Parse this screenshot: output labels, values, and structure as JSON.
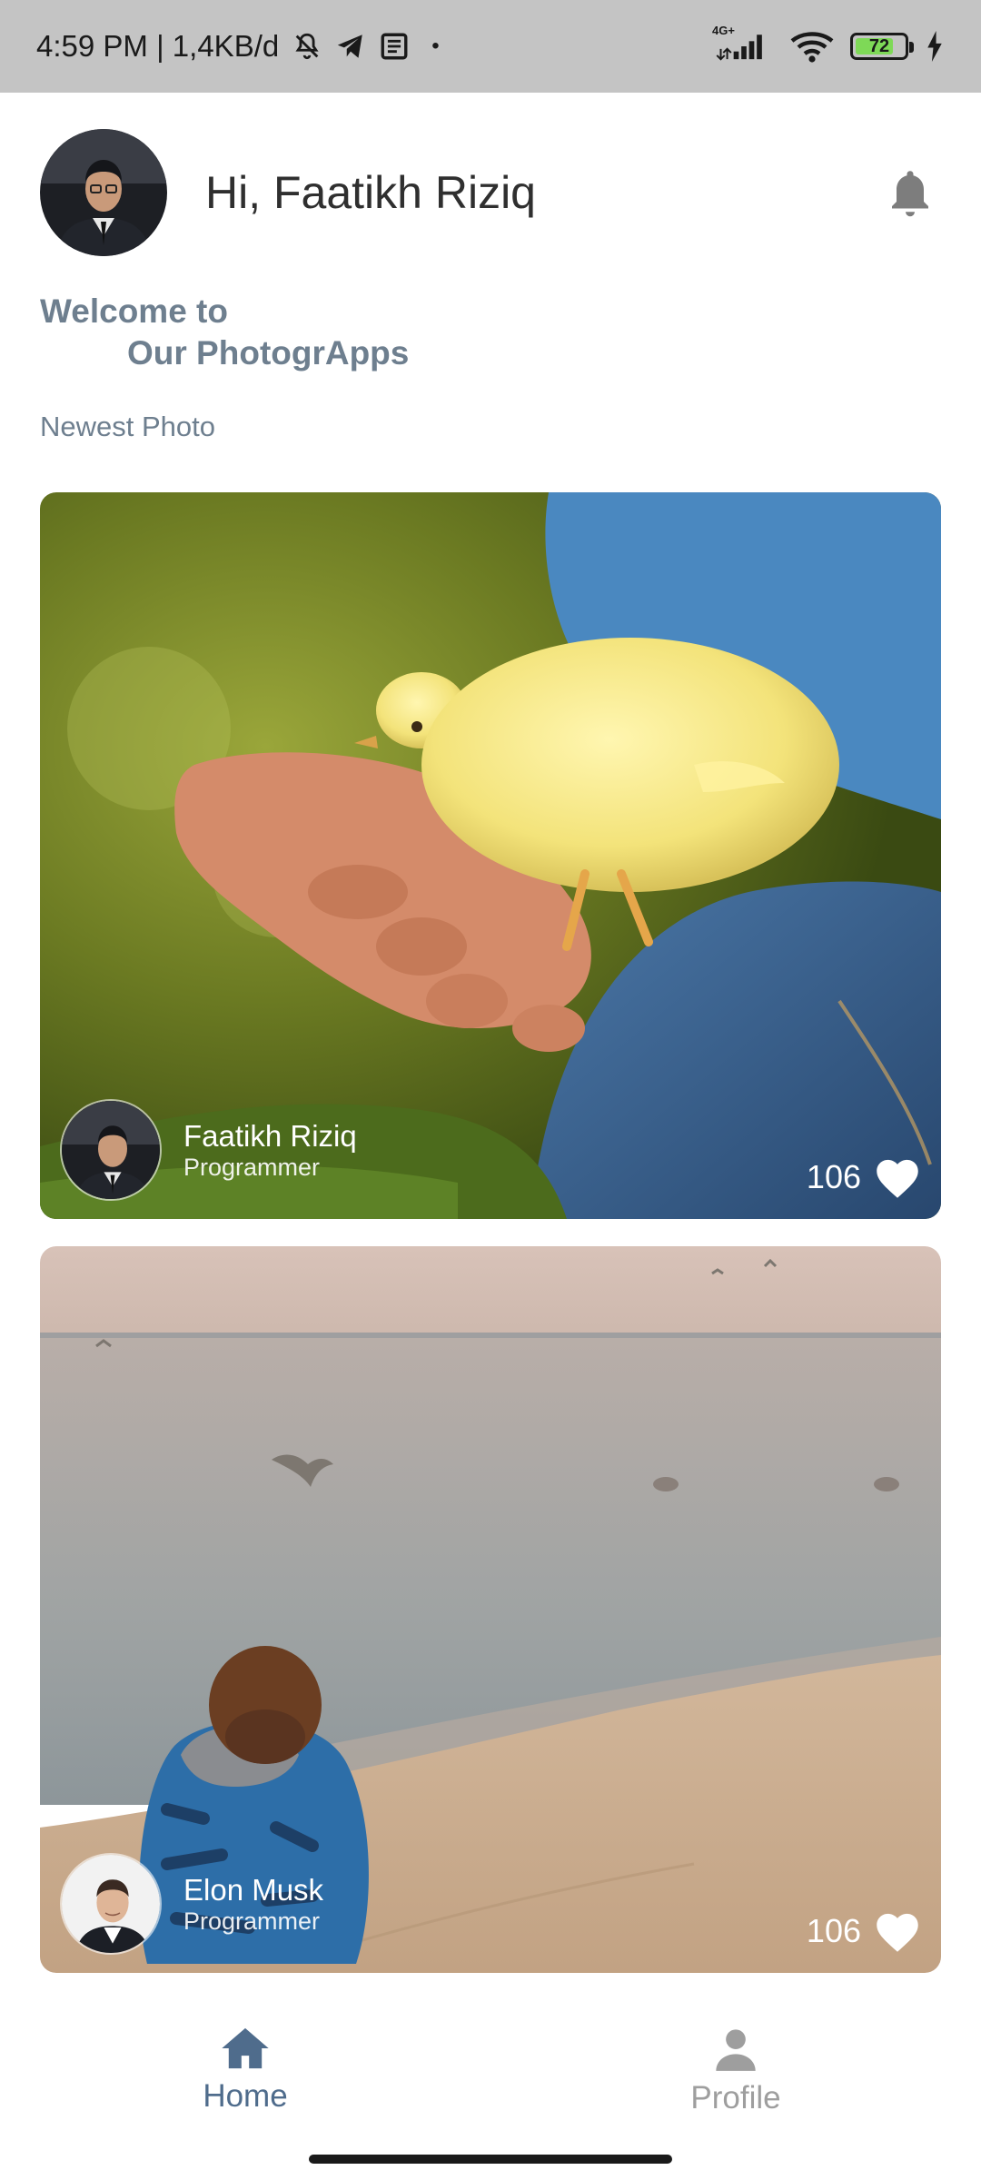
{
  "status_bar": {
    "time_info": "4:59 PM | 1,4KB/d",
    "dot": "•",
    "network_type": "4G+",
    "battery_level": "72"
  },
  "header": {
    "greeting": "Hi, Faatikh Riziq"
  },
  "welcome": {
    "line1": "Welcome to",
    "line2": "Our PhotogrApps"
  },
  "section_title": "Newest Photo",
  "posts": [
    {
      "owner_name": "Faatikh Riziq",
      "owner_role": "Programmer",
      "likes": "106"
    },
    {
      "owner_name": "Elon Musk",
      "owner_role": "Programmer",
      "likes": "106"
    }
  ],
  "bottom_nav": {
    "home_label": "Home",
    "profile_label": "Profile",
    "active": "Home"
  },
  "colors": {
    "accent": "#4f6c8c",
    "muted_text": "#6e7f8f",
    "status_bar_bg": "#c4c4c4"
  }
}
